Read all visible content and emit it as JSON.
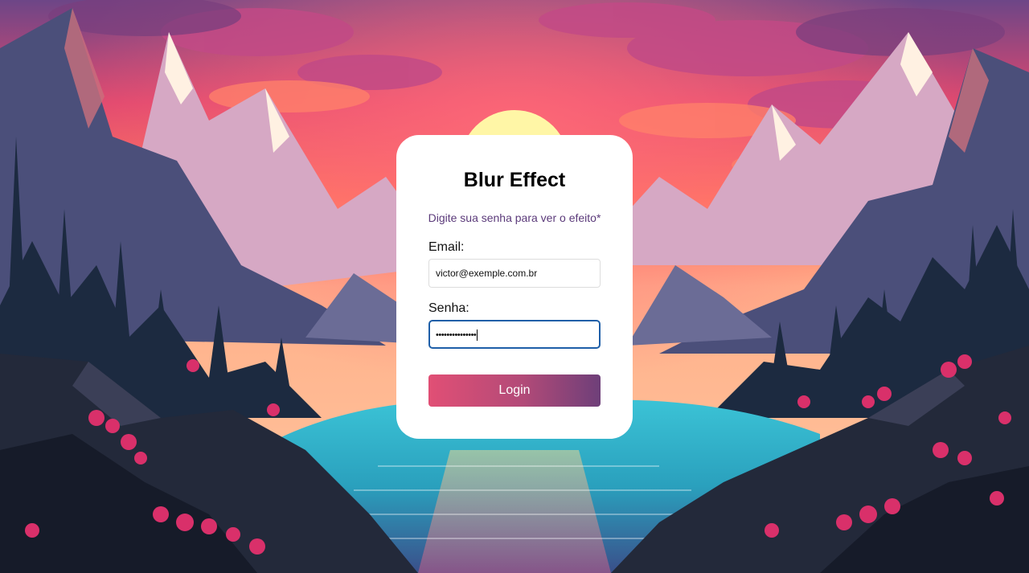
{
  "login_card": {
    "title": "Blur Effect",
    "subtitle": "Digite sua senha para ver o efeito*",
    "email_label": "Email:",
    "email_value": "victor@exemple.com.br",
    "password_label": "Senha:",
    "password_masked": "•••••••••••••••",
    "login_button_label": "Login"
  },
  "background": {
    "description_icon": "mountain-lake-sunset-landscape",
    "colors": {
      "sky_top": "#7a4a86",
      "sky_glow": "#ff4f78",
      "sun": "#fff6a6",
      "mountains_far": "#c7a6c9",
      "mountains_mid": "#5a5f8a",
      "forest": "#1c2a40",
      "lake": "#38b6c9",
      "foreground_rocks": "#1e2433",
      "flowers": "#d9306a"
    }
  },
  "accent": {
    "button_gradient_start": "#e14f75",
    "button_gradient_end": "#6e3f79",
    "focus_border": "#1e5fa8"
  }
}
